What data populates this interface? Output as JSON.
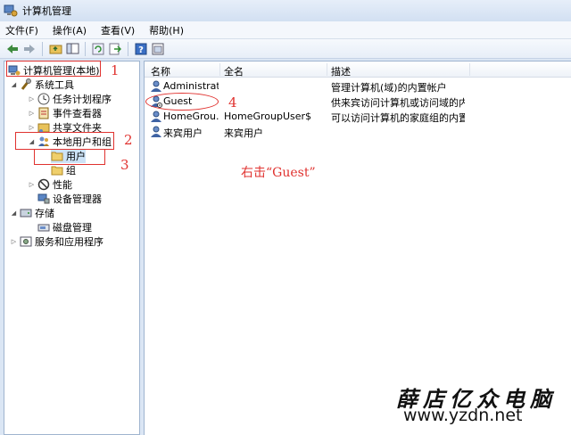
{
  "window": {
    "title": "计算机管理"
  },
  "menu": [
    "文件(F)",
    "操作(A)",
    "查看(V)",
    "帮助(H)"
  ],
  "tree": {
    "root": "计算机管理(本地)",
    "system_tools": "系统工具",
    "task_scheduler": "任务计划程序",
    "event_viewer": "事件查看器",
    "shared_folders": "共享文件夹",
    "local_users_groups": "本地用户和组",
    "users": "用户",
    "groups": "组",
    "performance": "性能",
    "device_manager": "设备管理器",
    "storage": "存储",
    "disk_management": "磁盘管理",
    "services_apps": "服务和应用程序"
  },
  "list": {
    "columns": [
      "名称",
      "全名",
      "描述"
    ],
    "rows": [
      {
        "name": "Administrat...",
        "fullname": "",
        "description": "管理计算机(域)的内置帐户"
      },
      {
        "name": "Guest",
        "fullname": "",
        "description": "供来宾访问计算机或访问域的内..."
      },
      {
        "name": "HomeGrou...",
        "fullname": "HomeGroupUser$",
        "description": "可以访问计算机的家庭组的内置..."
      },
      {
        "name": "来宾用户",
        "fullname": "来宾用户",
        "description": ""
      }
    ]
  },
  "annotations": {
    "n1": "1",
    "n2": "2",
    "n3": "3",
    "n4": "4",
    "instruction": "右击“Guest”"
  },
  "watermark": {
    "line1": "薛店亿众电脑",
    "line2": "www.yzdn.net"
  },
  "colors": {
    "annotation": "#e0322f",
    "pane_border": "#9fb4cf",
    "chrome": "#dbe6f4"
  }
}
